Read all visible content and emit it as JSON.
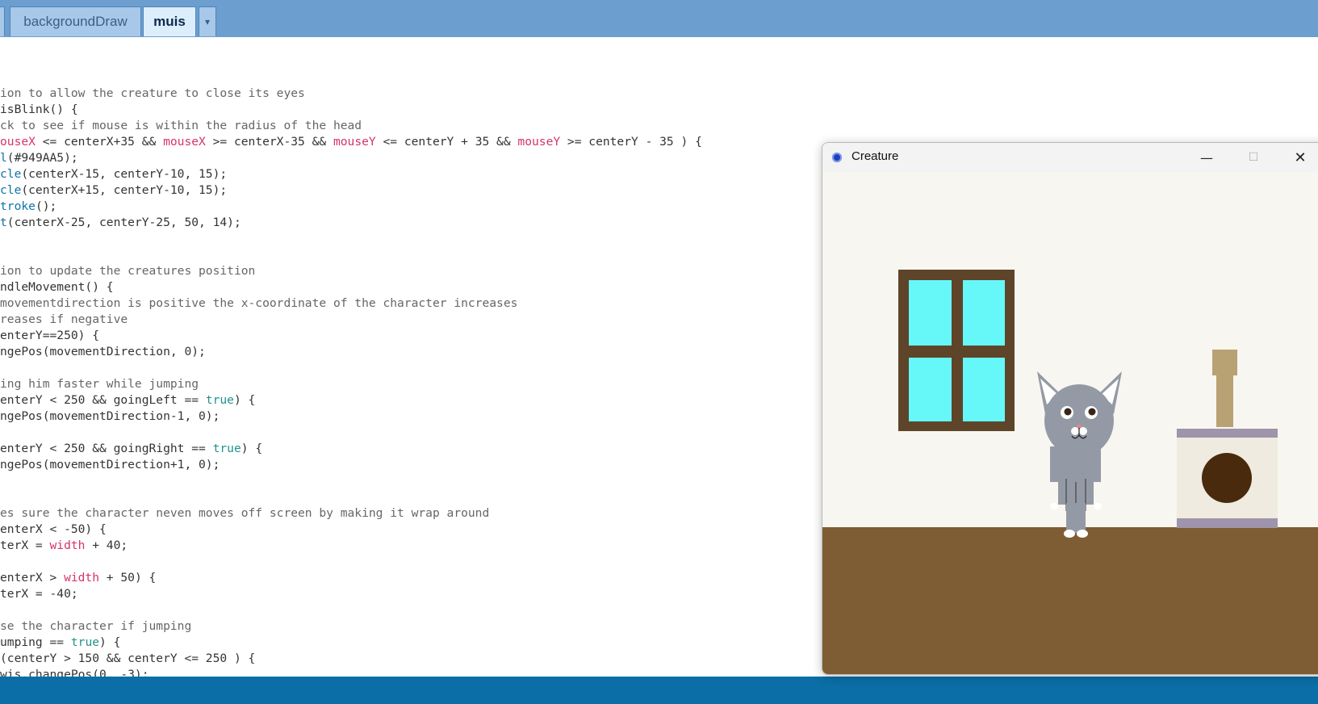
{
  "tabs": {
    "items": [
      {
        "label": "backgroundDraw"
      },
      {
        "label": "muis"
      }
    ],
    "menu_glyph": "▾"
  },
  "code_lines": [
    [
      {
        "t": "ion to allow the creature to close its eyes",
        "c": "cm"
      }
    ],
    [
      {
        "t": "isBlink() {",
        "c": ""
      }
    ],
    [
      {
        "t": "ck to see if mouse is within the radius of the head",
        "c": "cm"
      }
    ],
    [
      {
        "t": "ouseX",
        "c": "kw"
      },
      {
        "t": " <= centerX+35 && ",
        "c": ""
      },
      {
        "t": "mouseX",
        "c": "kw"
      },
      {
        "t": " >= centerX-35 && ",
        "c": ""
      },
      {
        "t": "mouseY",
        "c": "kw"
      },
      {
        "t": " <= centerY + 35 && ",
        "c": ""
      },
      {
        "t": "mouseY",
        "c": "kw"
      },
      {
        "t": " >= centerY - 35 ) {",
        "c": ""
      }
    ],
    [
      {
        "t": "l",
        "c": "fn"
      },
      {
        "t": "(#949AA5);",
        "c": ""
      }
    ],
    [
      {
        "t": "cle",
        "c": "fn"
      },
      {
        "t": "(centerX-15, centerY-10, 15);",
        "c": ""
      }
    ],
    [
      {
        "t": "cle",
        "c": "fn"
      },
      {
        "t": "(centerX+15, centerY-10, 15);",
        "c": ""
      }
    ],
    [
      {
        "t": "troke",
        "c": "fn"
      },
      {
        "t": "();",
        "c": ""
      }
    ],
    [
      {
        "t": "t",
        "c": "fn"
      },
      {
        "t": "(centerX-25, centerY-25, 50, 14);",
        "c": ""
      }
    ],
    [],
    [],
    [
      {
        "t": "ion to update the creatures position",
        "c": "cm"
      }
    ],
    [
      {
        "t": "ndleMovement() {",
        "c": ""
      }
    ],
    [
      {
        "t": "movementdirection is positive the x-coordinate of the character increases",
        "c": "cm"
      }
    ],
    [
      {
        "t": "reases if negative",
        "c": "cm"
      }
    ],
    [
      {
        "t": "enterY==250) {",
        "c": ""
      }
    ],
    [
      {
        "t": "ngePos(movementDirection, 0);",
        "c": ""
      }
    ],
    [],
    [
      {
        "t": "ing him faster while jumping",
        "c": "cm"
      }
    ],
    [
      {
        "t": "enterY < 250 && goingLeft == ",
        "c": ""
      },
      {
        "t": "true",
        "c": "bl"
      },
      {
        "t": ") {",
        "c": ""
      }
    ],
    [
      {
        "t": "ngePos(movementDirection-1, 0);",
        "c": ""
      }
    ],
    [],
    [
      {
        "t": "enterY < 250 && goingRight == ",
        "c": ""
      },
      {
        "t": "true",
        "c": "bl"
      },
      {
        "t": ") {",
        "c": ""
      }
    ],
    [
      {
        "t": "ngePos(movementDirection+1, 0);",
        "c": ""
      }
    ],
    [],
    [],
    [
      {
        "t": "es sure the character neven moves off screen by making it wrap around",
        "c": "cm"
      }
    ],
    [
      {
        "t": "enterX < -50) {",
        "c": ""
      }
    ],
    [
      {
        "t": "terX = ",
        "c": ""
      },
      {
        "t": "width",
        "c": "kw"
      },
      {
        "t": " + 40;",
        "c": ""
      }
    ],
    [],
    [
      {
        "t": "enterX > ",
        "c": ""
      },
      {
        "t": "width",
        "c": "kw"
      },
      {
        "t": " + 50) {",
        "c": ""
      }
    ],
    [
      {
        "t": "terX = -40;",
        "c": ""
      }
    ],
    [],
    [
      {
        "t": "se the character if jumping",
        "c": "cm"
      }
    ],
    [
      {
        "t": "umping == ",
        "c": ""
      },
      {
        "t": "true",
        "c": "bl"
      },
      {
        "t": ") {",
        "c": ""
      }
    ],
    [
      {
        "t": "(centerY > 150 && centerY <= 250 ) {",
        "c": ""
      }
    ],
    [
      {
        "t": "wis.changePos(0, -3);",
        "c": ""
      }
    ]
  ],
  "window": {
    "title": "Creature",
    "min_glyph": "—",
    "max_glyph": "☐",
    "close_glyph": "✕"
  },
  "scene": {
    "wall_color": "#f8f6f0",
    "floor_color": "#7e5d35",
    "window_frame_color": "#5e4429",
    "glass_color": "#66f8f8",
    "cat_color": "#949aa5",
    "tower_post_color": "#b8a274",
    "tower_box_color": "#efebe0",
    "tower_trim_color": "#9e94ab",
    "tower_hole_color": "#4a2a0c"
  }
}
